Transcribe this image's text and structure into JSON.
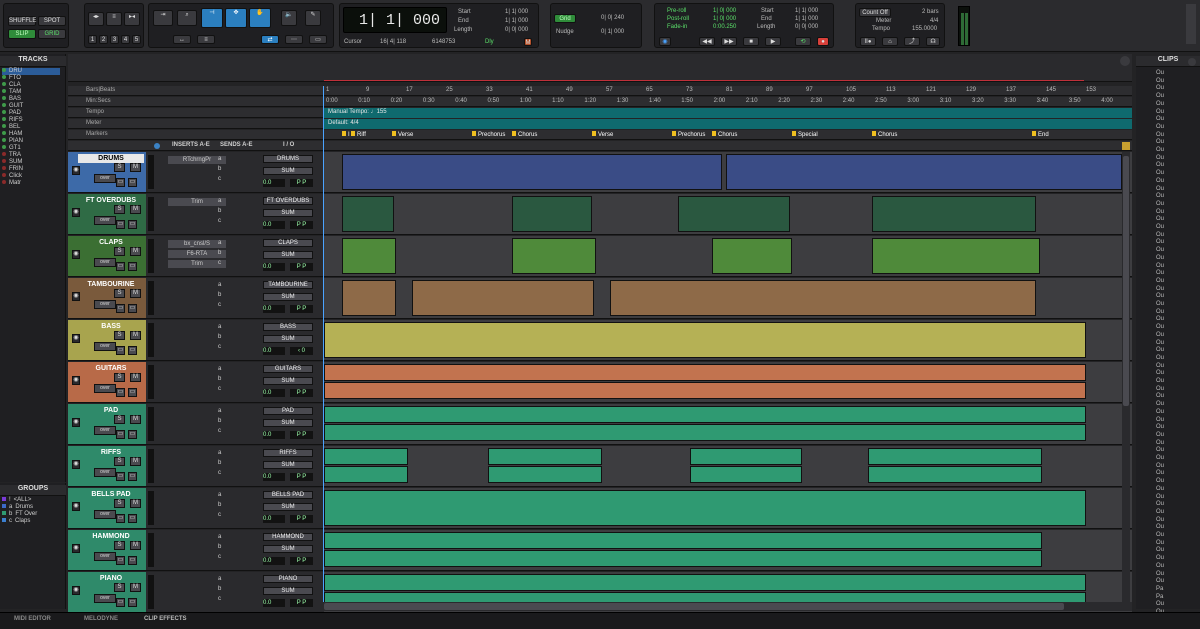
{
  "toolbar": {
    "edit_modes": [
      "SHUFFLE",
      "SPOT",
      "SLIP",
      "GRID"
    ],
    "zoom_presets": [
      "1",
      "2",
      "3",
      "4",
      "5"
    ],
    "main_counter": "1| 1| 000",
    "start_label": "Start",
    "end_label": "End",
    "length_label": "Length",
    "start": "1| 1| 000",
    "end": "1| 1| 000",
    "length": "0| 0| 000",
    "cursor_label": "Cursor",
    "cursor": "16| 4| 118",
    "sample": "6148753",
    "dly": "Dly",
    "grid_label": "Grid",
    "grid_value": "0| 0| 240",
    "nudge_label": "Nudge",
    "nudge_value": "0| 1| 000",
    "preroll_label": "Pre-roll",
    "preroll": "1| 0| 000",
    "postroll_label": "Post-roll",
    "postroll": "1| 0| 000",
    "fadein_label": "Fade-in",
    "fadein": "0:00.250",
    "t_start": "1| 1| 000",
    "t_end": "1| 1| 000",
    "t_length": "0| 0| 000",
    "countoff": "Count Off",
    "countoff_val": "2 bars",
    "meter_label": "Meter",
    "meter": "4/4",
    "tempo_label": "Tempo",
    "tempo": "155.0000"
  },
  "panels": {
    "tracks_title": "TRACKS",
    "groups_title": "GROUPS",
    "clips_title": "CLIPS"
  },
  "track_list": [
    "DRU",
    "FTO",
    "CLA",
    "TAM",
    "BAS",
    "GUIT",
    "PAD",
    "RIFS",
    "BEL",
    "HAM",
    "PIAN",
    "GT1",
    "TRA",
    "SUM",
    "FRIN",
    "Click",
    "Matr"
  ],
  "groups": [
    {
      "id": "!",
      "name": "<ALL>"
    },
    {
      "id": "a",
      "name": "Drums"
    },
    {
      "id": "b",
      "name": "FT Over"
    },
    {
      "id": "c",
      "name": "Claps"
    }
  ],
  "rulers": {
    "bars_beats": "Bars|Beats",
    "minsecs": "Min:Secs",
    "tempo": "Tempo",
    "meter": "Meter",
    "markers": "Markers",
    "manual_tempo": "Manual Tempo: ♩155",
    "default_meter": "Default: 4/4",
    "bars": [
      "1",
      "9",
      "17",
      "25",
      "33",
      "41",
      "49",
      "57",
      "65",
      "73",
      "81",
      "89",
      "97",
      "105",
      "113",
      "121",
      "129",
      "137",
      "145",
      "153"
    ],
    "times": [
      "0:00",
      "0:10",
      "0:20",
      "0:30",
      "0:40",
      "0:50",
      "1:00",
      "1:10",
      "1:20",
      "1:30",
      "1:40",
      "1:50",
      "2:00",
      "2:10",
      "2:20",
      "2:30",
      "2:40",
      "2:50",
      "3:00",
      "3:10",
      "3:20",
      "3:30",
      "3:40",
      "3:50",
      "4:00"
    ]
  },
  "markers": [
    "I",
    "Riff",
    "Verse",
    "Prechorus",
    "Chorus",
    "Verse",
    "Prechorus",
    "Chorus",
    "Special",
    "Chorus",
    "End"
  ],
  "column_headers": {
    "inserts": "INSERTS A-E",
    "sends": "SENDS A-E",
    "io": "I / O"
  },
  "tracks": [
    {
      "name": "DRUMS",
      "color": "#3d6aa8",
      "ins": [
        "RTchrngPr",
        "",
        ""
      ],
      "out": "DRUMS",
      "bus": "SUM",
      "vol": "0.0",
      "pan": "P  P",
      "lane": "#3a4c86"
    },
    {
      "name": "FT OVERDUBS",
      "color": "#2f6b45",
      "ins": [
        "Trim",
        "",
        ""
      ],
      "out": "FT OVERDUBS",
      "bus": "SUM",
      "vol": "0.0",
      "pan": "P  P",
      "lane": "#2a5840"
    },
    {
      "name": "CLAPS",
      "color": "#3b6f33",
      "ins": [
        "bx_cnsl/S",
        "F6-RTA",
        "Trim"
      ],
      "out": "CLAPS",
      "bus": "SUM",
      "vol": "0.0",
      "pan": "P  P",
      "lane": "#4f8a3a"
    },
    {
      "name": "TAMBOURINE",
      "color": "#7a5a3c",
      "ins": [
        "",
        "",
        ""
      ],
      "out": "TAMBOURINE",
      "bus": "SUM",
      "vol": "0.0",
      "pan": "P  P",
      "lane": "#8e6a48"
    },
    {
      "name": "BASS",
      "color": "#a8a44e",
      "ins": [
        "",
        "",
        ""
      ],
      "out": "BASS",
      "bus": "SUM",
      "vol": "0.0",
      "pan": "‹  0",
      "lane": "#b5b155"
    },
    {
      "name": "GUITARS",
      "color": "#b86a48",
      "ins": [
        "",
        "",
        ""
      ],
      "out": "GUITARS",
      "bus": "SUM",
      "vol": "0.0",
      "pan": "P  P",
      "lane": "#c2734f"
    },
    {
      "name": "PAD",
      "color": "#2f8a6a",
      "ins": [
        "",
        "",
        ""
      ],
      "out": "PAD",
      "bus": "SUM",
      "vol": "0.0",
      "pan": "P  P",
      "lane": "#2f9a72"
    },
    {
      "name": "RIFFS",
      "color": "#2f8a6a",
      "ins": [
        "",
        "",
        ""
      ],
      "out": "RIFFS",
      "bus": "SUM",
      "vol": "0.0",
      "pan": "P  P",
      "lane": "#2f9a72"
    },
    {
      "name": "BELLS PAD",
      "color": "#2f8a6a",
      "ins": [
        "",
        "",
        ""
      ],
      "out": "BELLS PAD",
      "bus": "SUM",
      "vol": "0.0",
      "pan": "P  P",
      "lane": "#2f9a72"
    },
    {
      "name": "HAMMOND",
      "color": "#2f8a6a",
      "ins": [
        "",
        "",
        ""
      ],
      "out": "HAMMOND",
      "bus": "SUM",
      "vol": "0.0",
      "pan": "P  P",
      "lane": "#2f9a72"
    },
    {
      "name": "PIANO",
      "color": "#2f8a6a",
      "ins": [
        "",
        "",
        ""
      ],
      "out": "PIANO",
      "bus": "SUM",
      "vol": "0.0",
      "pan": "P  P",
      "lane": "#2f9a72"
    }
  ],
  "track_buttons": {
    "solo": "S",
    "mute": "M",
    "auto": "over"
  },
  "clips_items": [
    "Ou",
    "Ou",
    "Ou",
    "Ou",
    "Ou",
    "Ou",
    "Ou",
    "Ou",
    "Ou",
    "Ou",
    "Ou",
    "Ou",
    "Ou",
    "Ou",
    "Ou",
    "Ou",
    "Ou",
    "Ou",
    "Ou",
    "Ou",
    "Ou",
    "Ou",
    "Ou",
    "Ou",
    "Ou",
    "Ou",
    "Ou",
    "Ou",
    "Ou",
    "Ou",
    "Ou",
    "Ou",
    "Ou",
    "Ou",
    "Ou",
    "Ou",
    "Ou",
    "Ou",
    "Ou",
    "Ou",
    "Ou",
    "Ou",
    "Ou",
    "Ou",
    "Ou",
    "Ou",
    "Ou",
    "Ou",
    "Ou",
    "Ou",
    "Ou",
    "Ou",
    "Ou",
    "Ou",
    "Ou",
    "Ou",
    "Ou",
    "Ou",
    "Ou",
    "Ou",
    "Ou",
    "Ou",
    "Ou",
    "Ou",
    "Ou",
    "Ou",
    "Ou",
    "Pa",
    "Pa",
    "Ou",
    "Ou"
  ],
  "bottom_tabs": [
    "MIDI EDITOR",
    "MELODYNE",
    "CLIP EFFECTS"
  ]
}
